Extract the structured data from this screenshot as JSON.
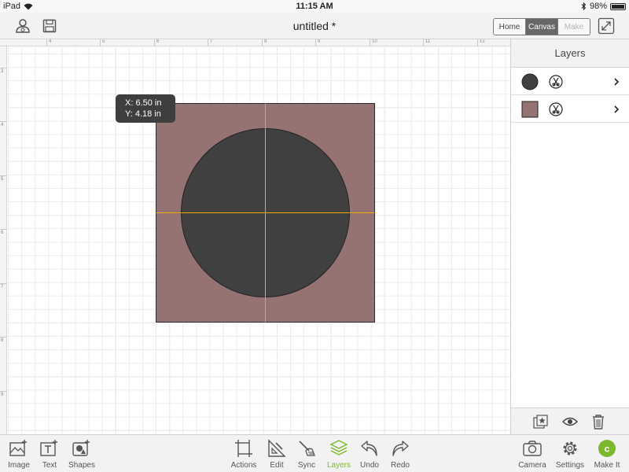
{
  "status_bar": {
    "carrier": "iPad",
    "time": "11:15 AM",
    "battery": "98%"
  },
  "toolbar": {
    "title": "untitled *",
    "modes": [
      "Home",
      "Canvas",
      "Make"
    ],
    "active_mode": "Canvas"
  },
  "canvas": {
    "ruler_top": [
      "4",
      "5",
      "6",
      "7",
      "8",
      "9",
      "10",
      "11",
      "12"
    ],
    "ruler_left": [
      "3",
      "4",
      "5",
      "6",
      "7",
      "8",
      "9"
    ],
    "tooltip": {
      "x": "X: 6.50 in",
      "y": "Y: 4.18 in"
    },
    "colors": {
      "square": "#967373",
      "circle": "#404040",
      "guide": "#f5a800"
    }
  },
  "layers": {
    "title": "Layers",
    "items": [
      {
        "shape": "circle",
        "color": "#404040"
      },
      {
        "shape": "square",
        "color": "#967373"
      }
    ]
  },
  "bottom_toolbar": {
    "left": [
      "Image",
      "Text",
      "Shapes"
    ],
    "center": [
      "Actions",
      "Edit",
      "Sync",
      "Layers",
      "Undo",
      "Redo"
    ],
    "right": [
      "Camera",
      "Settings",
      "Make It"
    ],
    "active": "Layers",
    "accent": "#7cb82f"
  }
}
